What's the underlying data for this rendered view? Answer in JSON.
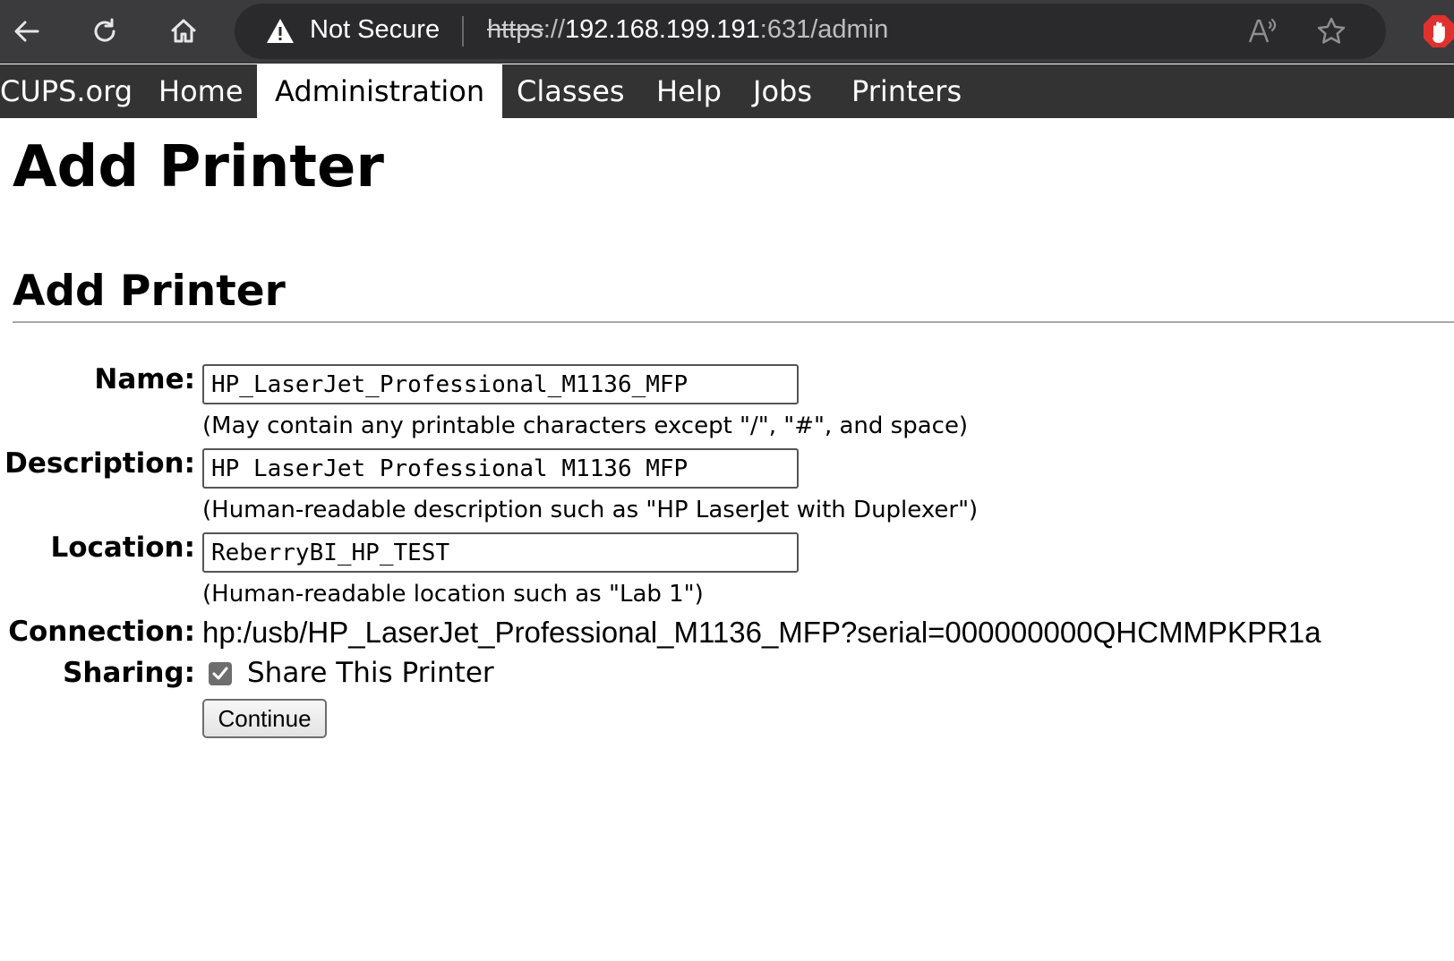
{
  "browser": {
    "security_text": "Not Secure",
    "url_scheme": "https",
    "url_sep": "://",
    "url_host": "192.168.199.191",
    "url_port_path": ":631/admin"
  },
  "nav": {
    "items": [
      {
        "label": "CUPS.org"
      },
      {
        "label": "Home"
      },
      {
        "label": "Administration",
        "active": true
      },
      {
        "label": "Classes"
      },
      {
        "label": "Help"
      },
      {
        "label": "Jobs"
      },
      {
        "label": "Printers"
      }
    ]
  },
  "page": {
    "title": "Add Printer",
    "section_title": "Add Printer"
  },
  "form": {
    "name_label": "Name:",
    "name_value": "HP_LaserJet_Professional_M1136_MFP",
    "name_hint": "(May contain any printable characters except \"/\", \"#\", and space)",
    "description_label": "Description:",
    "description_value": "HP LaserJet Professional M1136 MFP",
    "description_hint": "(Human-readable description such as \"HP LaserJet with Duplexer\")",
    "location_label": "Location:",
    "location_value": "ReberryBI_HP_TEST",
    "location_hint": "(Human-readable location such as \"Lab 1\")",
    "connection_label": "Connection:",
    "connection_value": "hp:/usb/HP_LaserJet_Professional_M1136_MFP?serial=000000000QHCMMPKPR1a",
    "sharing_label": "Sharing:",
    "sharing_checked": true,
    "sharing_option": "Share This Printer",
    "continue_label": "Continue"
  },
  "colors": {
    "toolbar_bg": "#3b3b3e",
    "nav_bg": "#333333",
    "nav_active_bg": "#ffffff",
    "extension_red": "#e0312f"
  }
}
